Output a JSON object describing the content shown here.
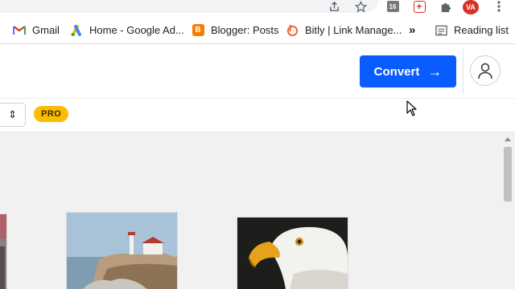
{
  "browser": {
    "toolbar_icons": [
      "share-icon",
      "star-icon",
      "extension-16-icon",
      "extension-plus-icon",
      "puzzle-icon",
      "profile-avatar-icon",
      "menu-kebab-icon"
    ],
    "avatar_initials": "VA",
    "bookmarks": [
      {
        "label": "Gmail",
        "icon": "gmail-icon"
      },
      {
        "label": "Home - Google Ad...",
        "icon": "google-ads-icon"
      },
      {
        "label": "Blogger: Posts",
        "icon": "blogger-icon"
      },
      {
        "label": "Bitly | Link Manage...",
        "icon": "bitly-icon"
      }
    ],
    "overflow": "»",
    "reading_list": "Reading list"
  },
  "header": {
    "convert_label": "Convert",
    "convert_arrow": "→",
    "accent": "#0b5cff"
  },
  "toolbar": {
    "select_caret": "⇕",
    "pro_badge": "PRO"
  },
  "gallery": {
    "items": [
      {
        "name": "partial-image-left"
      },
      {
        "name": "lighthouse-photo"
      },
      {
        "name": "eagle-photo"
      }
    ]
  }
}
